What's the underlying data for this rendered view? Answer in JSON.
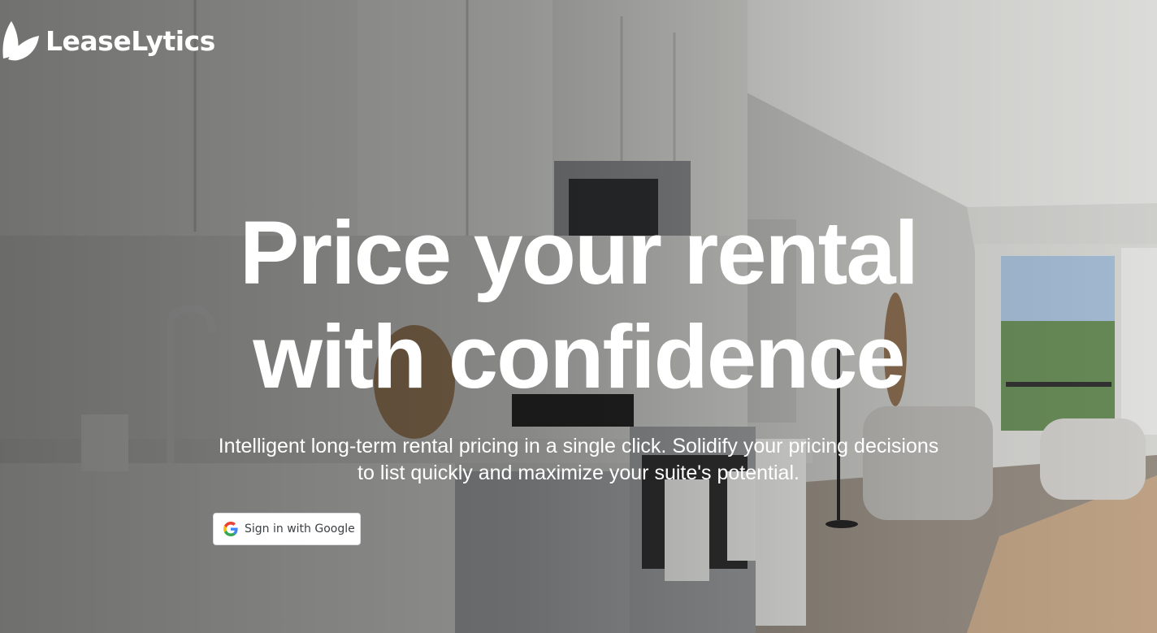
{
  "brand": {
    "name": "LeaseLytics",
    "logo_icon": "leaf-logo-icon"
  },
  "hero": {
    "title_line1": "Price your rental",
    "title_line2": "with confidence",
    "subtitle": "Intelligent long-term rental pricing in a single click. Solidify your pricing decisions to list quickly and maximize your suite's potential."
  },
  "auth": {
    "google_button_label": "Sign in with Google",
    "google_icon": "google-g-icon"
  },
  "background": {
    "description_icon": "kitchen-photo",
    "overlay_color": "#141414"
  }
}
